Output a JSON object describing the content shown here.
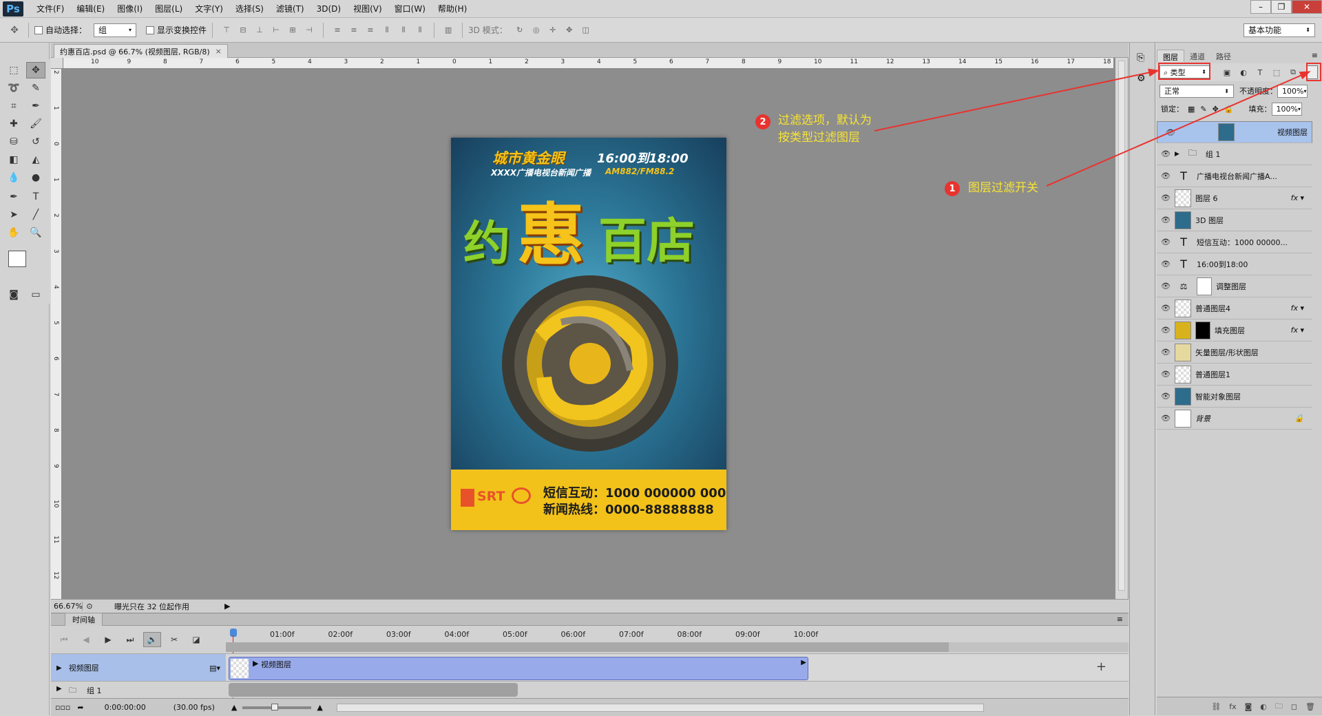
{
  "app": {
    "logo": "Ps"
  },
  "menu": [
    "文件(F)",
    "编辑(E)",
    "图像(I)",
    "图层(L)",
    "文字(Y)",
    "选择(S)",
    "滤镜(T)",
    "3D(D)",
    "视图(V)",
    "窗口(W)",
    "帮助(H)"
  ],
  "options_bar": {
    "auto_select_label": "自动选择：",
    "auto_select_value": "组",
    "show_transform_label": "显示变换控件",
    "mode_3d_label": "3D 模式：",
    "workspace": "基本功能"
  },
  "document": {
    "tab_title": "约惠百店.psd @ 66.7% (视频图层, RGB/8)",
    "zoom": "66.67%",
    "status": "曝光只在 32 位起作用",
    "ruler_h": [
      "10",
      "8",
      "6",
      "4",
      "2",
      "0",
      "2",
      "4",
      "6",
      "8",
      "10",
      "12",
      "14",
      "16",
      "18"
    ],
    "ruler_h_minor": [
      "9",
      "7",
      "5",
      "3",
      "1",
      "1",
      "3",
      "5",
      "7",
      "9",
      "11",
      "13",
      "15",
      "17"
    ],
    "ruler_v": [
      "2",
      "1",
      "0",
      "1",
      "2",
      "3",
      "4",
      "5",
      "6",
      "7",
      "8",
      "9",
      "10",
      "11",
      "12"
    ]
  },
  "poster": {
    "top_title": "城市黄金眼",
    "time": "16:00到18:00",
    "station": "XXXX广播电视台新闻广播",
    "freq": "AM882/FM88.2",
    "big_1": "约",
    "big_2": "惠",
    "big_3": "百店",
    "logo_srt": "SRT",
    "sms": "短信互动：1000 000000 000",
    "hotline": "新闻热线：0000-88888888"
  },
  "timeline": {
    "title": "时间轴",
    "ticks": [
      "01:00f",
      "02:00f",
      "03:00f",
      "04:00f",
      "05:00f",
      "06:00f",
      "07:00f",
      "08:00f",
      "09:00f",
      "10:00f"
    ],
    "track1": "视频图层",
    "clip": "视频图层",
    "track2": "组 1",
    "timecode": "0:00:00:00",
    "fps": "(30.00 fps)"
  },
  "layers_panel": {
    "tabs": [
      "图层",
      "通道",
      "路径"
    ],
    "kind": "类型",
    "blend": "正常",
    "opacity_label": "不透明度：",
    "opacity": "100%",
    "lock_label": "锁定：",
    "fill_label": "填充：",
    "fill": "100%",
    "layers": [
      {
        "name": "视频图层",
        "icon": "video",
        "selected": true,
        "fx": false
      },
      {
        "name": "组 1",
        "icon": "group",
        "selected": false,
        "fx": false
      },
      {
        "name": "广播电视台新闻广播A...",
        "icon": "text",
        "selected": false,
        "fx": false
      },
      {
        "name": "图层 6",
        "icon": "image",
        "selected": false,
        "fx": true
      },
      {
        "name": "3D 图层",
        "icon": "3d",
        "selected": false,
        "fx": false
      },
      {
        "name": "短信互动：1000 00000...",
        "icon": "text",
        "selected": false,
        "fx": false
      },
      {
        "name": "16:00到18:00",
        "icon": "text",
        "selected": false,
        "fx": false
      },
      {
        "name": "调整图层",
        "icon": "adjust",
        "selected": false,
        "fx": false
      },
      {
        "name": "普通图层4",
        "icon": "image",
        "selected": false,
        "fx": true
      },
      {
        "name": "填充图层",
        "icon": "fill",
        "selected": false,
        "fx": true
      },
      {
        "name": "矢量图层/形状图层",
        "icon": "shape",
        "selected": false,
        "fx": false
      },
      {
        "name": "普通图层1",
        "icon": "image",
        "selected": false,
        "fx": false
      },
      {
        "name": "智能对象图层",
        "icon": "smart",
        "selected": false,
        "fx": false
      },
      {
        "name": "背景",
        "icon": "bg",
        "selected": false,
        "fx": false
      }
    ]
  },
  "annotations": {
    "a1_num": "1",
    "a1_text": "图层过滤开关",
    "a2_num": "2",
    "a2_line1": "过滤选项，默认为",
    "a2_line2": "按类型过滤图层"
  },
  "colors": {
    "annotation": "#e8332f",
    "annotation_text": "#f7e433",
    "selected_layer": "#a8c3ec",
    "clip": "#98aaea"
  }
}
